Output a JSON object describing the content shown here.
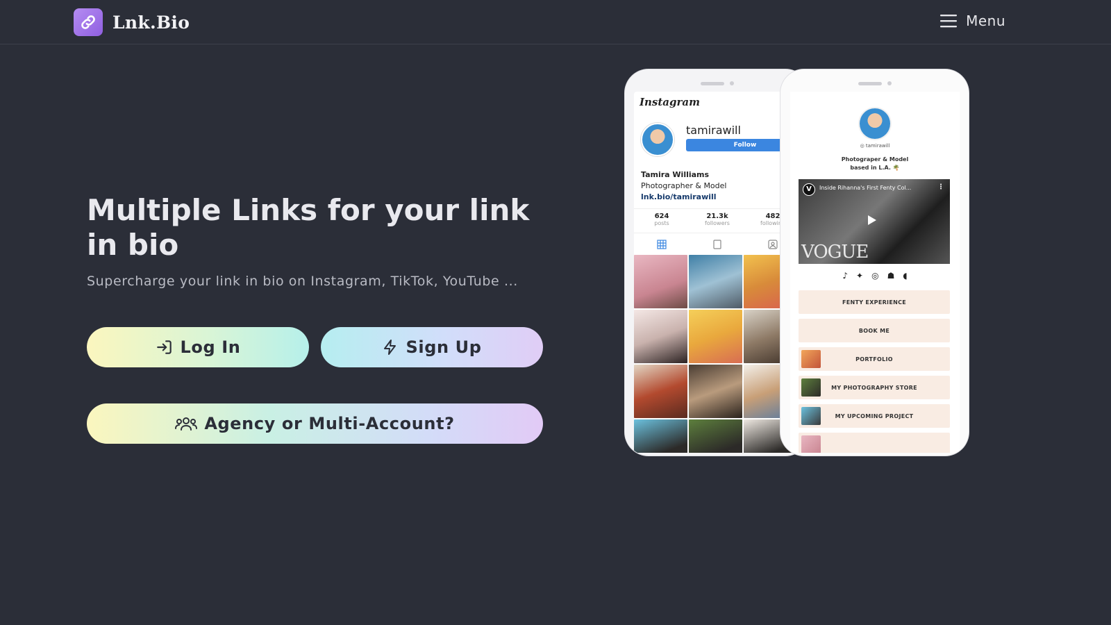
{
  "header": {
    "brand": "Lnk.Bio",
    "menu_label": "Menu"
  },
  "hero": {
    "title": "Multiple Links for your link in bio",
    "subtitle": "Supercharge your link in bio on Instagram, TikTok, YouTube ...",
    "login_label": "Log In",
    "signup_label": "Sign Up",
    "agency_label": "Agency or Multi-Account?"
  },
  "mockup_instagram": {
    "wordmark": "Instagram",
    "username": "tamirawill",
    "follow_label": "Follow",
    "bio_name": "Tamira Williams",
    "bio_role": "Photographer & Model",
    "bio_link": "lnk.bio/tamirawill",
    "stats": [
      {
        "n": "624",
        "l": "posts"
      },
      {
        "n": "21.3k",
        "l": "followers"
      },
      {
        "n": "482",
        "l": "following"
      }
    ]
  },
  "mockup_lnkbio": {
    "handle": "◎ tamirawill",
    "tagline_1": "Photograper & Model",
    "tagline_2": "based in L.A. 🌴",
    "video_title": "Inside Rihanna's First Fenty Col...",
    "video_brand": "VOGUE",
    "links": [
      "FENTY EXPERIENCE",
      "BOOK ME",
      "PORTFOLIO",
      "MY PHOTOGRAPHY STORE",
      "MY UPCOMING PROJECT"
    ]
  }
}
